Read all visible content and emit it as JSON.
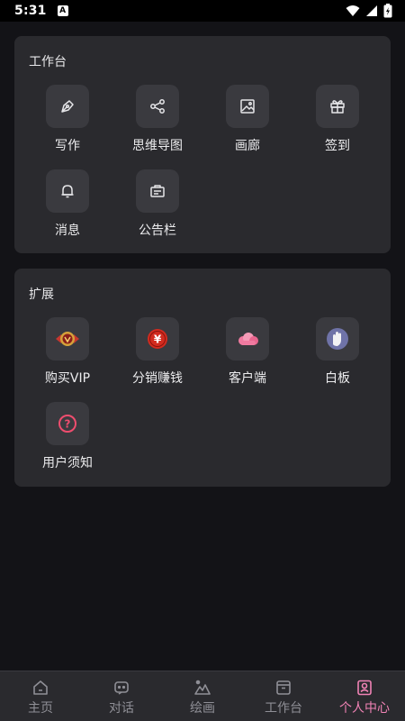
{
  "status": {
    "time": "5:31",
    "badge": "A"
  },
  "workbench": {
    "title": "工作台",
    "items": [
      {
        "label": "写作",
        "icon": "pen-icon"
      },
      {
        "label": "思维导图",
        "icon": "mindmap-icon"
      },
      {
        "label": "画廊",
        "icon": "image-icon"
      },
      {
        "label": "签到",
        "icon": "gift-icon"
      },
      {
        "label": "消息",
        "icon": "bell-icon"
      },
      {
        "label": "公告栏",
        "icon": "notice-board-icon"
      }
    ]
  },
  "extensions": {
    "title": "扩展",
    "items": [
      {
        "label": "购买VIP",
        "icon": "vip-badge-icon"
      },
      {
        "label": "分销赚钱",
        "icon": "yuan-coin-icon",
        "glyph": "¥"
      },
      {
        "label": "客户端",
        "icon": "cloud-icon"
      },
      {
        "label": "白板",
        "icon": "whiteboard-hand-icon"
      },
      {
        "label": "用户须知",
        "icon": "question-icon",
        "glyph": "?"
      }
    ]
  },
  "nav": {
    "items": [
      {
        "label": "主页",
        "icon": "home-icon"
      },
      {
        "label": "对话",
        "icon": "chat-icon"
      },
      {
        "label": "绘画",
        "icon": "paint-icon"
      },
      {
        "label": "工作台",
        "icon": "archive-icon"
      },
      {
        "label": "个人中心",
        "icon": "profile-icon"
      }
    ],
    "active_index": 4,
    "active_color": "#f183b5",
    "inactive_color": "#8f8f96"
  }
}
